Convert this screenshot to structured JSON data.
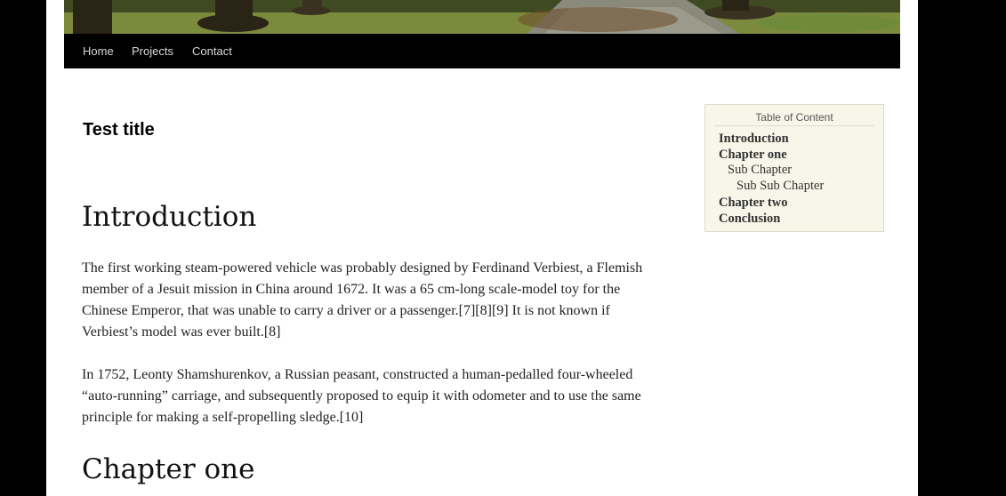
{
  "nav": {
    "items": [
      {
        "label": "Home"
      },
      {
        "label": "Projects"
      },
      {
        "label": "Contact"
      }
    ]
  },
  "post": {
    "title": "Test title"
  },
  "content": {
    "introduction": {
      "heading": "Introduction",
      "paragraphs": [
        "The first working steam-powered vehicle was probably designed by Ferdinand Verbiest, a Flemish member of a Jesuit mission in China around 1672. It was a 65 cm-long scale-model toy for the Chinese Emperor, that was unable to carry a driver or a passenger.[7][8][9] It is not known if Verbiest’s model was ever built.[8]",
        "In 1752, Leonty Shamshurenkov, a Russian peasant, constructed a human-pedalled four-wheeled “auto-running” carriage, and subsequently proposed to equip it with odometer and to use the same principle for making a self-propelling sledge.[10]"
      ]
    },
    "chapter_one": {
      "heading": "Chapter one"
    }
  },
  "toc": {
    "title": "Table of Content",
    "items": [
      {
        "label": "Introduction",
        "level": 1
      },
      {
        "label": "Chapter one",
        "level": 1
      },
      {
        "label": "Sub Chapter",
        "level": 2
      },
      {
        "label": "Sub Sub Chapter",
        "level": 3
      },
      {
        "label": "Chapter two",
        "level": 1
      },
      {
        "label": "Conclusion",
        "level": 1
      }
    ]
  }
}
